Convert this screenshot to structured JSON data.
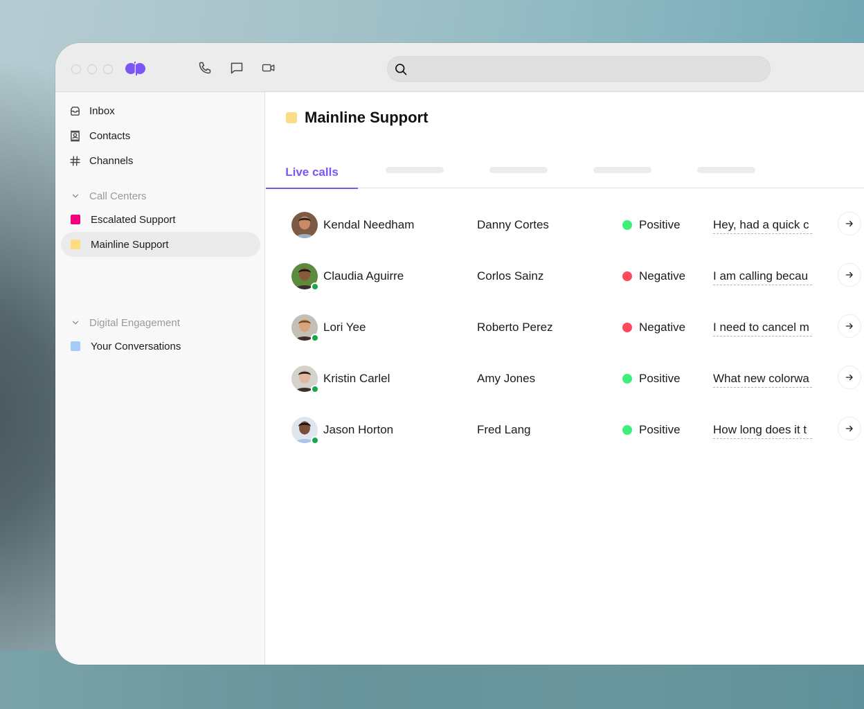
{
  "titlebar": {
    "window_controls": [
      "close",
      "minimize",
      "maximize"
    ],
    "logo": "dialpad-logo",
    "icons": [
      "phone-icon",
      "chat-icon",
      "video-icon"
    ],
    "search": {
      "placeholder": "",
      "value": ""
    }
  },
  "sidebar": {
    "items": [
      {
        "label": "Inbox",
        "icon": "inbox-icon"
      },
      {
        "label": "Contacts",
        "icon": "contacts-icon"
      },
      {
        "label": "Channels",
        "icon": "hash-icon"
      }
    ],
    "sections": [
      {
        "label": "Call Centers",
        "items": [
          {
            "label": "Escalated Support",
            "color": "#f5007c"
          },
          {
            "label": "Mainline Support",
            "color": "#fedb85",
            "active": true
          }
        ]
      },
      {
        "label": "Digital Engagement",
        "items": [
          {
            "label": "Your Conversations",
            "color": "#a4ccfb"
          }
        ]
      }
    ]
  },
  "main": {
    "title": "Mainline Support",
    "title_color": "#fedb85",
    "tabs": [
      {
        "label": "Live calls",
        "active": true
      },
      {
        "label": "",
        "placeholder": true
      },
      {
        "label": "",
        "placeholder": true
      },
      {
        "label": "",
        "placeholder": true
      },
      {
        "label": "",
        "placeholder": true
      }
    ],
    "calls": [
      {
        "agent": "Kendal Needham",
        "caller": "Danny Cortes",
        "sentiment": "Positive",
        "snippet": "Hey, had a quick c",
        "online": false
      },
      {
        "agent": "Claudia Aguirre",
        "caller": "Corlos Sainz",
        "sentiment": "Negative",
        "snippet": "I am calling becau",
        "online": true
      },
      {
        "agent": "Lori Yee",
        "caller": "Roberto Perez",
        "sentiment": "Negative",
        "snippet": "I need to cancel m",
        "online": true
      },
      {
        "agent": "Kristin Carlel",
        "caller": "Amy Jones",
        "sentiment": "Positive",
        "snippet": "What new colorwa",
        "online": true
      },
      {
        "agent": "Jason Horton",
        "caller": "Fred Lang",
        "sentiment": "Positive",
        "snippet": "How long does it t",
        "online": true
      }
    ]
  },
  "colors": {
    "accent": "#7b55f6",
    "positive": "#3ef07a",
    "negative": "#fd4a5c",
    "presence": "#1ba64a"
  }
}
